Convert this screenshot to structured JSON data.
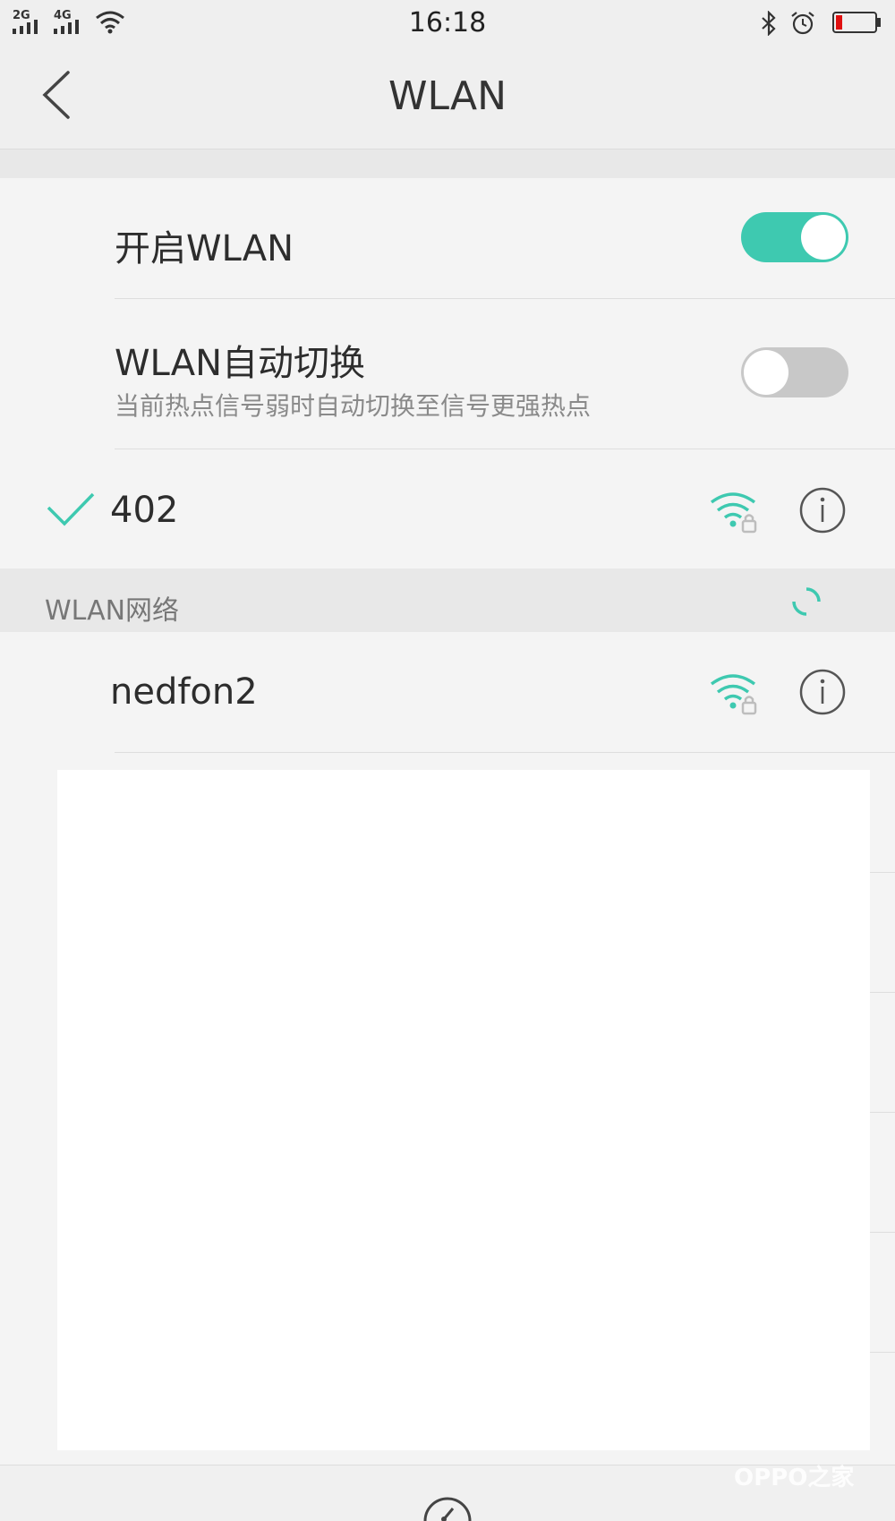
{
  "status_bar": {
    "time": "16:18",
    "net1": "2G",
    "net2": "4G",
    "icons": [
      "signal-icon",
      "signal-icon",
      "wifi-icon",
      "bluetooth-icon",
      "alarm-icon",
      "battery-low-icon"
    ],
    "battery_color": "#e01010"
  },
  "header": {
    "title": "WLAN"
  },
  "settings": {
    "enable_wlan": {
      "label": "开启WLAN",
      "on": true
    },
    "auto_switch": {
      "label": "WLAN自动切换",
      "description": "当前热点信号弱时自动切换至信号更强热点",
      "on": false
    }
  },
  "connected_network": {
    "ssid": "402",
    "secured": true
  },
  "networks_section": {
    "label": "WLAN网络"
  },
  "networks": [
    {
      "ssid": "nedfon2",
      "secured": true
    }
  ],
  "watermark": {
    "text": "OPPO之家"
  },
  "colors": {
    "accent": "#3ec9b0",
    "toggle_off": "#c8c8c8"
  }
}
